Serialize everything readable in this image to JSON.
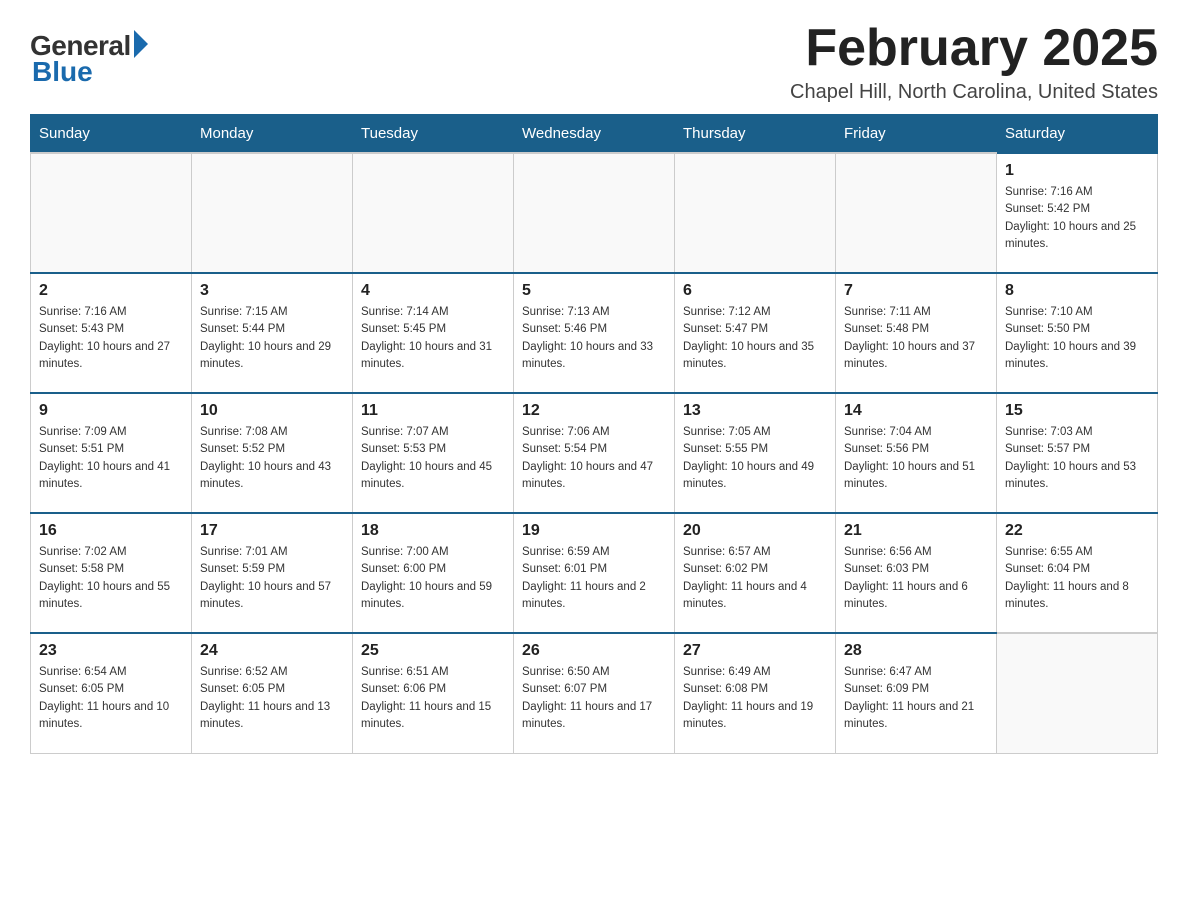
{
  "logo": {
    "general": "General",
    "blue": "Blue"
  },
  "title": "February 2025",
  "location": "Chapel Hill, North Carolina, United States",
  "days_of_week": [
    "Sunday",
    "Monday",
    "Tuesday",
    "Wednesday",
    "Thursday",
    "Friday",
    "Saturday"
  ],
  "weeks": [
    [
      {
        "day": "",
        "sunrise": "",
        "sunset": "",
        "daylight": ""
      },
      {
        "day": "",
        "sunrise": "",
        "sunset": "",
        "daylight": ""
      },
      {
        "day": "",
        "sunrise": "",
        "sunset": "",
        "daylight": ""
      },
      {
        "day": "",
        "sunrise": "",
        "sunset": "",
        "daylight": ""
      },
      {
        "day": "",
        "sunrise": "",
        "sunset": "",
        "daylight": ""
      },
      {
        "day": "",
        "sunrise": "",
        "sunset": "",
        "daylight": ""
      },
      {
        "day": "1",
        "sunrise": "Sunrise: 7:16 AM",
        "sunset": "Sunset: 5:42 PM",
        "daylight": "Daylight: 10 hours and 25 minutes."
      }
    ],
    [
      {
        "day": "2",
        "sunrise": "Sunrise: 7:16 AM",
        "sunset": "Sunset: 5:43 PM",
        "daylight": "Daylight: 10 hours and 27 minutes."
      },
      {
        "day": "3",
        "sunrise": "Sunrise: 7:15 AM",
        "sunset": "Sunset: 5:44 PM",
        "daylight": "Daylight: 10 hours and 29 minutes."
      },
      {
        "day": "4",
        "sunrise": "Sunrise: 7:14 AM",
        "sunset": "Sunset: 5:45 PM",
        "daylight": "Daylight: 10 hours and 31 minutes."
      },
      {
        "day": "5",
        "sunrise": "Sunrise: 7:13 AM",
        "sunset": "Sunset: 5:46 PM",
        "daylight": "Daylight: 10 hours and 33 minutes."
      },
      {
        "day": "6",
        "sunrise": "Sunrise: 7:12 AM",
        "sunset": "Sunset: 5:47 PM",
        "daylight": "Daylight: 10 hours and 35 minutes."
      },
      {
        "day": "7",
        "sunrise": "Sunrise: 7:11 AM",
        "sunset": "Sunset: 5:48 PM",
        "daylight": "Daylight: 10 hours and 37 minutes."
      },
      {
        "day": "8",
        "sunrise": "Sunrise: 7:10 AM",
        "sunset": "Sunset: 5:50 PM",
        "daylight": "Daylight: 10 hours and 39 minutes."
      }
    ],
    [
      {
        "day": "9",
        "sunrise": "Sunrise: 7:09 AM",
        "sunset": "Sunset: 5:51 PM",
        "daylight": "Daylight: 10 hours and 41 minutes."
      },
      {
        "day": "10",
        "sunrise": "Sunrise: 7:08 AM",
        "sunset": "Sunset: 5:52 PM",
        "daylight": "Daylight: 10 hours and 43 minutes."
      },
      {
        "day": "11",
        "sunrise": "Sunrise: 7:07 AM",
        "sunset": "Sunset: 5:53 PM",
        "daylight": "Daylight: 10 hours and 45 minutes."
      },
      {
        "day": "12",
        "sunrise": "Sunrise: 7:06 AM",
        "sunset": "Sunset: 5:54 PM",
        "daylight": "Daylight: 10 hours and 47 minutes."
      },
      {
        "day": "13",
        "sunrise": "Sunrise: 7:05 AM",
        "sunset": "Sunset: 5:55 PM",
        "daylight": "Daylight: 10 hours and 49 minutes."
      },
      {
        "day": "14",
        "sunrise": "Sunrise: 7:04 AM",
        "sunset": "Sunset: 5:56 PM",
        "daylight": "Daylight: 10 hours and 51 minutes."
      },
      {
        "day": "15",
        "sunrise": "Sunrise: 7:03 AM",
        "sunset": "Sunset: 5:57 PM",
        "daylight": "Daylight: 10 hours and 53 minutes."
      }
    ],
    [
      {
        "day": "16",
        "sunrise": "Sunrise: 7:02 AM",
        "sunset": "Sunset: 5:58 PM",
        "daylight": "Daylight: 10 hours and 55 minutes."
      },
      {
        "day": "17",
        "sunrise": "Sunrise: 7:01 AM",
        "sunset": "Sunset: 5:59 PM",
        "daylight": "Daylight: 10 hours and 57 minutes."
      },
      {
        "day": "18",
        "sunrise": "Sunrise: 7:00 AM",
        "sunset": "Sunset: 6:00 PM",
        "daylight": "Daylight: 10 hours and 59 minutes."
      },
      {
        "day": "19",
        "sunrise": "Sunrise: 6:59 AM",
        "sunset": "Sunset: 6:01 PM",
        "daylight": "Daylight: 11 hours and 2 minutes."
      },
      {
        "day": "20",
        "sunrise": "Sunrise: 6:57 AM",
        "sunset": "Sunset: 6:02 PM",
        "daylight": "Daylight: 11 hours and 4 minutes."
      },
      {
        "day": "21",
        "sunrise": "Sunrise: 6:56 AM",
        "sunset": "Sunset: 6:03 PM",
        "daylight": "Daylight: 11 hours and 6 minutes."
      },
      {
        "day": "22",
        "sunrise": "Sunrise: 6:55 AM",
        "sunset": "Sunset: 6:04 PM",
        "daylight": "Daylight: 11 hours and 8 minutes."
      }
    ],
    [
      {
        "day": "23",
        "sunrise": "Sunrise: 6:54 AM",
        "sunset": "Sunset: 6:05 PM",
        "daylight": "Daylight: 11 hours and 10 minutes."
      },
      {
        "day": "24",
        "sunrise": "Sunrise: 6:52 AM",
        "sunset": "Sunset: 6:05 PM",
        "daylight": "Daylight: 11 hours and 13 minutes."
      },
      {
        "day": "25",
        "sunrise": "Sunrise: 6:51 AM",
        "sunset": "Sunset: 6:06 PM",
        "daylight": "Daylight: 11 hours and 15 minutes."
      },
      {
        "day": "26",
        "sunrise": "Sunrise: 6:50 AM",
        "sunset": "Sunset: 6:07 PM",
        "daylight": "Daylight: 11 hours and 17 minutes."
      },
      {
        "day": "27",
        "sunrise": "Sunrise: 6:49 AM",
        "sunset": "Sunset: 6:08 PM",
        "daylight": "Daylight: 11 hours and 19 minutes."
      },
      {
        "day": "28",
        "sunrise": "Sunrise: 6:47 AM",
        "sunset": "Sunset: 6:09 PM",
        "daylight": "Daylight: 11 hours and 21 minutes."
      },
      {
        "day": "",
        "sunrise": "",
        "sunset": "",
        "daylight": ""
      }
    ]
  ]
}
